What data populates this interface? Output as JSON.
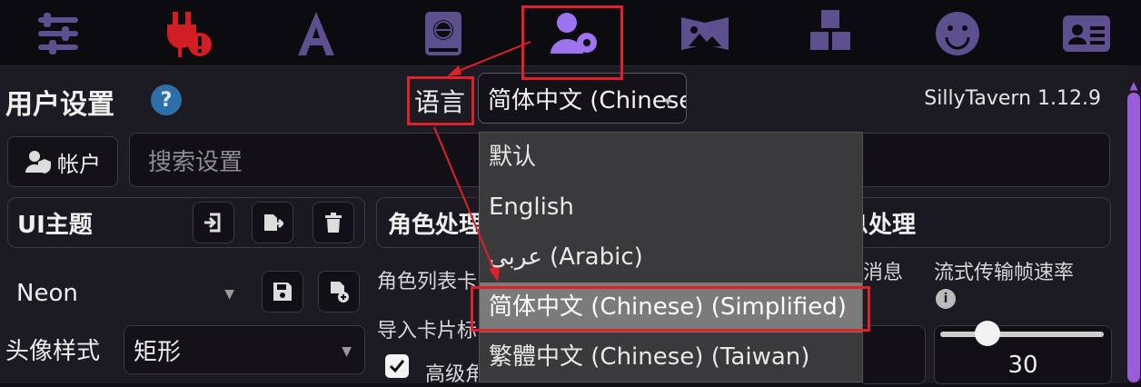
{
  "top_icons": [
    {
      "name": "sliders-icon"
    },
    {
      "name": "plug-error-icon"
    },
    {
      "name": "font-a-icon"
    },
    {
      "name": "book-globe-icon"
    },
    {
      "name": "user-gear-icon"
    },
    {
      "name": "image-icon"
    },
    {
      "name": "cubes-icon"
    },
    {
      "name": "smiley-icon"
    },
    {
      "name": "id-card-icon"
    }
  ],
  "header": {
    "title": "用户设置",
    "help": "?",
    "language_label": "语言",
    "language_value": "简体中文 (Chinese) (Simplified)",
    "version": "SillyTavern 1.12.9"
  },
  "account": {
    "label": "帐户"
  },
  "search": {
    "placeholder": "搜索设置"
  },
  "sections": {
    "ui_theme": "UI主题",
    "character_handling": "角色处理",
    "message_handling": "消息处理"
  },
  "theme": {
    "value": "Neon"
  },
  "avatar": {
    "label": "头像样式",
    "value": "矩形"
  },
  "middle": {
    "row1": "角色列表卡",
    "row2": "导入卡片标",
    "row3": "高级角"
  },
  "right": {
    "msg_label": "消息",
    "stream_label": "流式传输帧速率",
    "stream_value": "30"
  },
  "dropdown": {
    "options": [
      "默认",
      "English",
      "عربي (Arabic)",
      "简体中文 (Chinese) (Simplified)",
      "繁體中文 (Chinese) (Taiwan)"
    ],
    "selected_index": 3
  },
  "colors": {
    "accent": "#9d73f0",
    "highlight": "#e0202a",
    "plug_red": "#e0202a"
  }
}
